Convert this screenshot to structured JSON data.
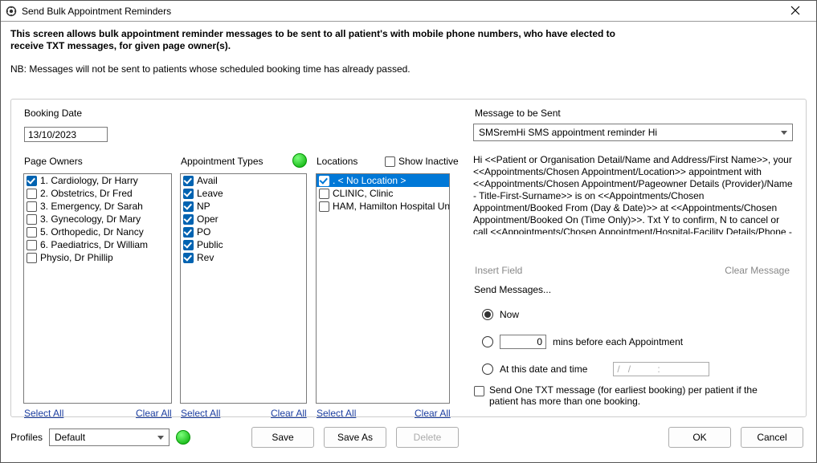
{
  "window_title": "Send Bulk Appointment Reminders",
  "intro_line1": "This screen allows bulk appointment reminder messages to be sent to all patient's with mobile phone numbers, who have elected to",
  "intro_line2": "receive TXT messages, for given page owner(s).",
  "intro_nb": "NB: Messages will not be sent  to patients whose scheduled booking time has already passed.",
  "booking_date_label": "Booking Date",
  "booking_date_value": "13/10/2023",
  "page_owners_label": "Page Owners",
  "appointment_types_label": "Appointment Types",
  "locations_label": "Locations",
  "show_inactive_label": "Show Inactive",
  "select_all": "Select All",
  "clear_all": "Clear All",
  "page_owners": [
    {
      "label": "1. Cardiology, Dr Harry",
      "checked": true
    },
    {
      "label": "2. Obstetrics, Dr Fred",
      "checked": false
    },
    {
      "label": "3. Emergency, Dr Sarah",
      "checked": false
    },
    {
      "label": "3. Gynecology, Dr Mary",
      "checked": false
    },
    {
      "label": "5. Orthopedic, Dr Nancy",
      "checked": false
    },
    {
      "label": "6. Paediatrics, Dr William",
      "checked": false
    },
    {
      "label": "Physio, Dr Phillip",
      "checked": false
    }
  ],
  "appointment_types": [
    {
      "label": "Avail",
      "checked": true
    },
    {
      "label": "Leave",
      "checked": true
    },
    {
      "label": "NP",
      "checked": true
    },
    {
      "label": "Oper",
      "checked": true
    },
    {
      "label": "PO",
      "checked": true
    },
    {
      "label": "Public",
      "checked": true
    },
    {
      "label": "Rev",
      "checked": true
    }
  ],
  "locations": [
    {
      "label": ". < No Location >",
      "checked": true,
      "selected": true
    },
    {
      "label": "CLINIC, Clinic",
      "checked": false,
      "selected": false
    },
    {
      "label": "HAM, Hamilton Hospital Unit",
      "checked": false,
      "selected": false
    }
  ],
  "message_label": "Message to be Sent",
  "message_template_name": "SMSremHi  SMS appointment reminder Hi",
  "message_body": "Hi <<Patient or Organisation Detail/Name and Address/First Name>>, your <<Appointments/Chosen Appointment/Location>> appointment with <<Appointments/Chosen Appointment/Pageowner Details (Provider)/Name - Title-First-Surname>> is on <<Appointments/Chosen Appointment/Booked From (Day & Date)>> at <<Appointments/Chosen Appointment/Booked On (Time Only)>>. Txt Y to confirm, N to cancel or call <<Appointments/Chosen Appointment/Hospital-Facility Details/Phone - Bus>> to rebook",
  "insert_field": "Insert Field",
  "clear_message": "Clear Message",
  "send_messages_label": "Send Messages...",
  "radio_now": "Now",
  "radio_mins_value": "0",
  "radio_mins_suffix": "mins before each Appointment",
  "radio_at": "At this date and time",
  "radio_at_value": "/   /          :",
  "send_one_label": "Send One TXT message (for earliest booking) per patient if the patient has more than one booking.",
  "profiles_label": "Profiles",
  "profiles_value": "Default",
  "btn_save": "Save",
  "btn_save_as": "Save As",
  "btn_delete": "Delete",
  "btn_ok": "OK",
  "btn_cancel": "Cancel"
}
